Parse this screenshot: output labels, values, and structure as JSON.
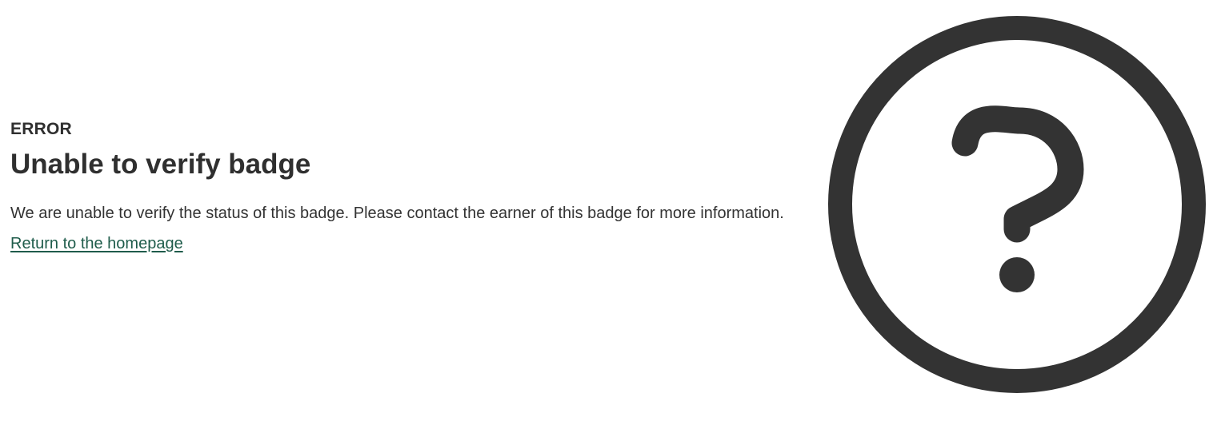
{
  "error_page": {
    "eyebrow": "ERROR",
    "title": "Unable to verify badge",
    "message": "We are unable to verify the status of this badge. Please contact the earner of this badge for more information.",
    "home_link_label": "Return to the homepage"
  },
  "illustration": {
    "icon": "question-mark-circle-icon",
    "color": "#333333"
  },
  "theme": {
    "text_color": "#2f2f2f",
    "link_color": "#1f5c4b",
    "background": "#ffffff"
  }
}
